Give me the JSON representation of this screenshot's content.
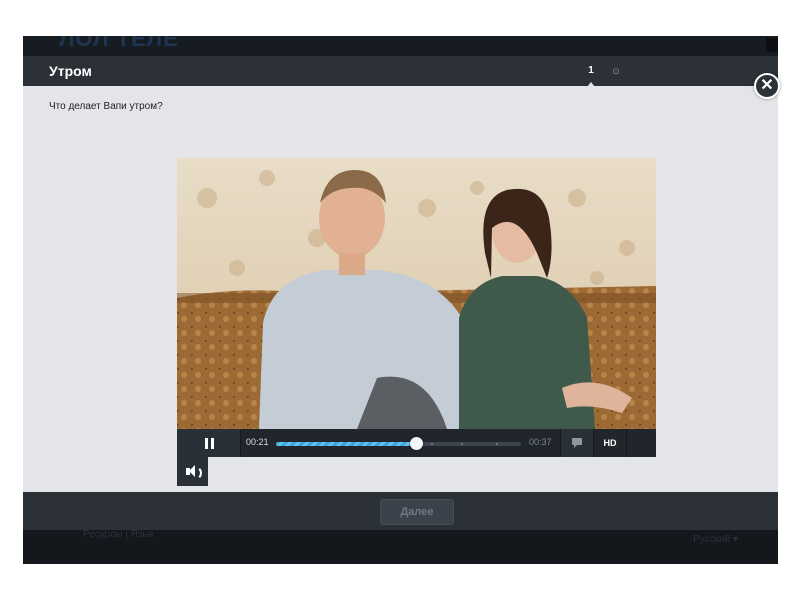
{
  "background": {
    "logo_text": "ЛОЛ ТЕЛЕ",
    "footer_left": "Ресурсы | Язык",
    "footer_right": "Русский ▾"
  },
  "modal": {
    "title": "Утром",
    "steps": [
      {
        "label": "1",
        "active": true
      },
      {
        "label": "⊙",
        "active": false
      }
    ],
    "question": "Что делает Вапи утром?",
    "next_label": "Далее",
    "close_icon": "✕"
  },
  "player": {
    "current_time": "00:21",
    "total_time": "00:37",
    "progress": 0.57,
    "hd_label": "HD",
    "state": "playing",
    "icons": {
      "pause": "pause-icon",
      "subtitles": "subtitles-icon",
      "volume": "volume-icon"
    }
  },
  "colors": {
    "accent": "#3aa6dc",
    "header_bg": "#2c3138",
    "body_bg": "#e3e5e8"
  }
}
